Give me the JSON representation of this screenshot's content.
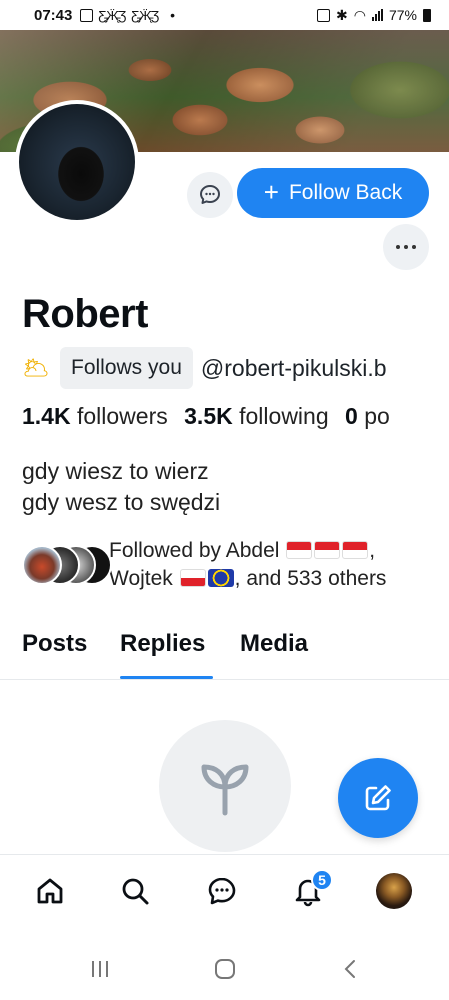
{
  "status_bar": {
    "time": "07:43",
    "battery": "77%"
  },
  "profile": {
    "display_name": "Robert",
    "follows_you_label": "Follows you",
    "handle": "@robert-pikulski.b",
    "followers_count": "1.4K",
    "followers_label": "followers",
    "following_count": "3.5K",
    "following_label": "following",
    "posts_count": "0",
    "posts_label": "po",
    "bio_line1": "gdy wiesz to wierz",
    "bio_line2": "gdy wesz to swędzi"
  },
  "actions": {
    "follow_back_label": "Follow Back",
    "follow_plus": "+"
  },
  "followed_by": {
    "prefix": "Followed by Abdel",
    "middle": ", Wojtek",
    "suffix": ", and 533 others"
  },
  "tabs": [
    {
      "label": "Posts"
    },
    {
      "label": "Replies"
    },
    {
      "label": "Media"
    }
  ],
  "active_tab": "Replies",
  "notifications_badge": "5",
  "colors": {
    "accent": "#1f84f2",
    "chip_bg": "#eef1f4",
    "text": "#0b0f14"
  },
  "icons": {
    "message": "chat-bubble-icon",
    "more": "more-dots-icon",
    "empty_state": "sprout-icon",
    "compose": "compose-icon",
    "home": "home-icon",
    "search": "search-icon",
    "chat": "chat-icon",
    "bell": "bell-icon"
  }
}
